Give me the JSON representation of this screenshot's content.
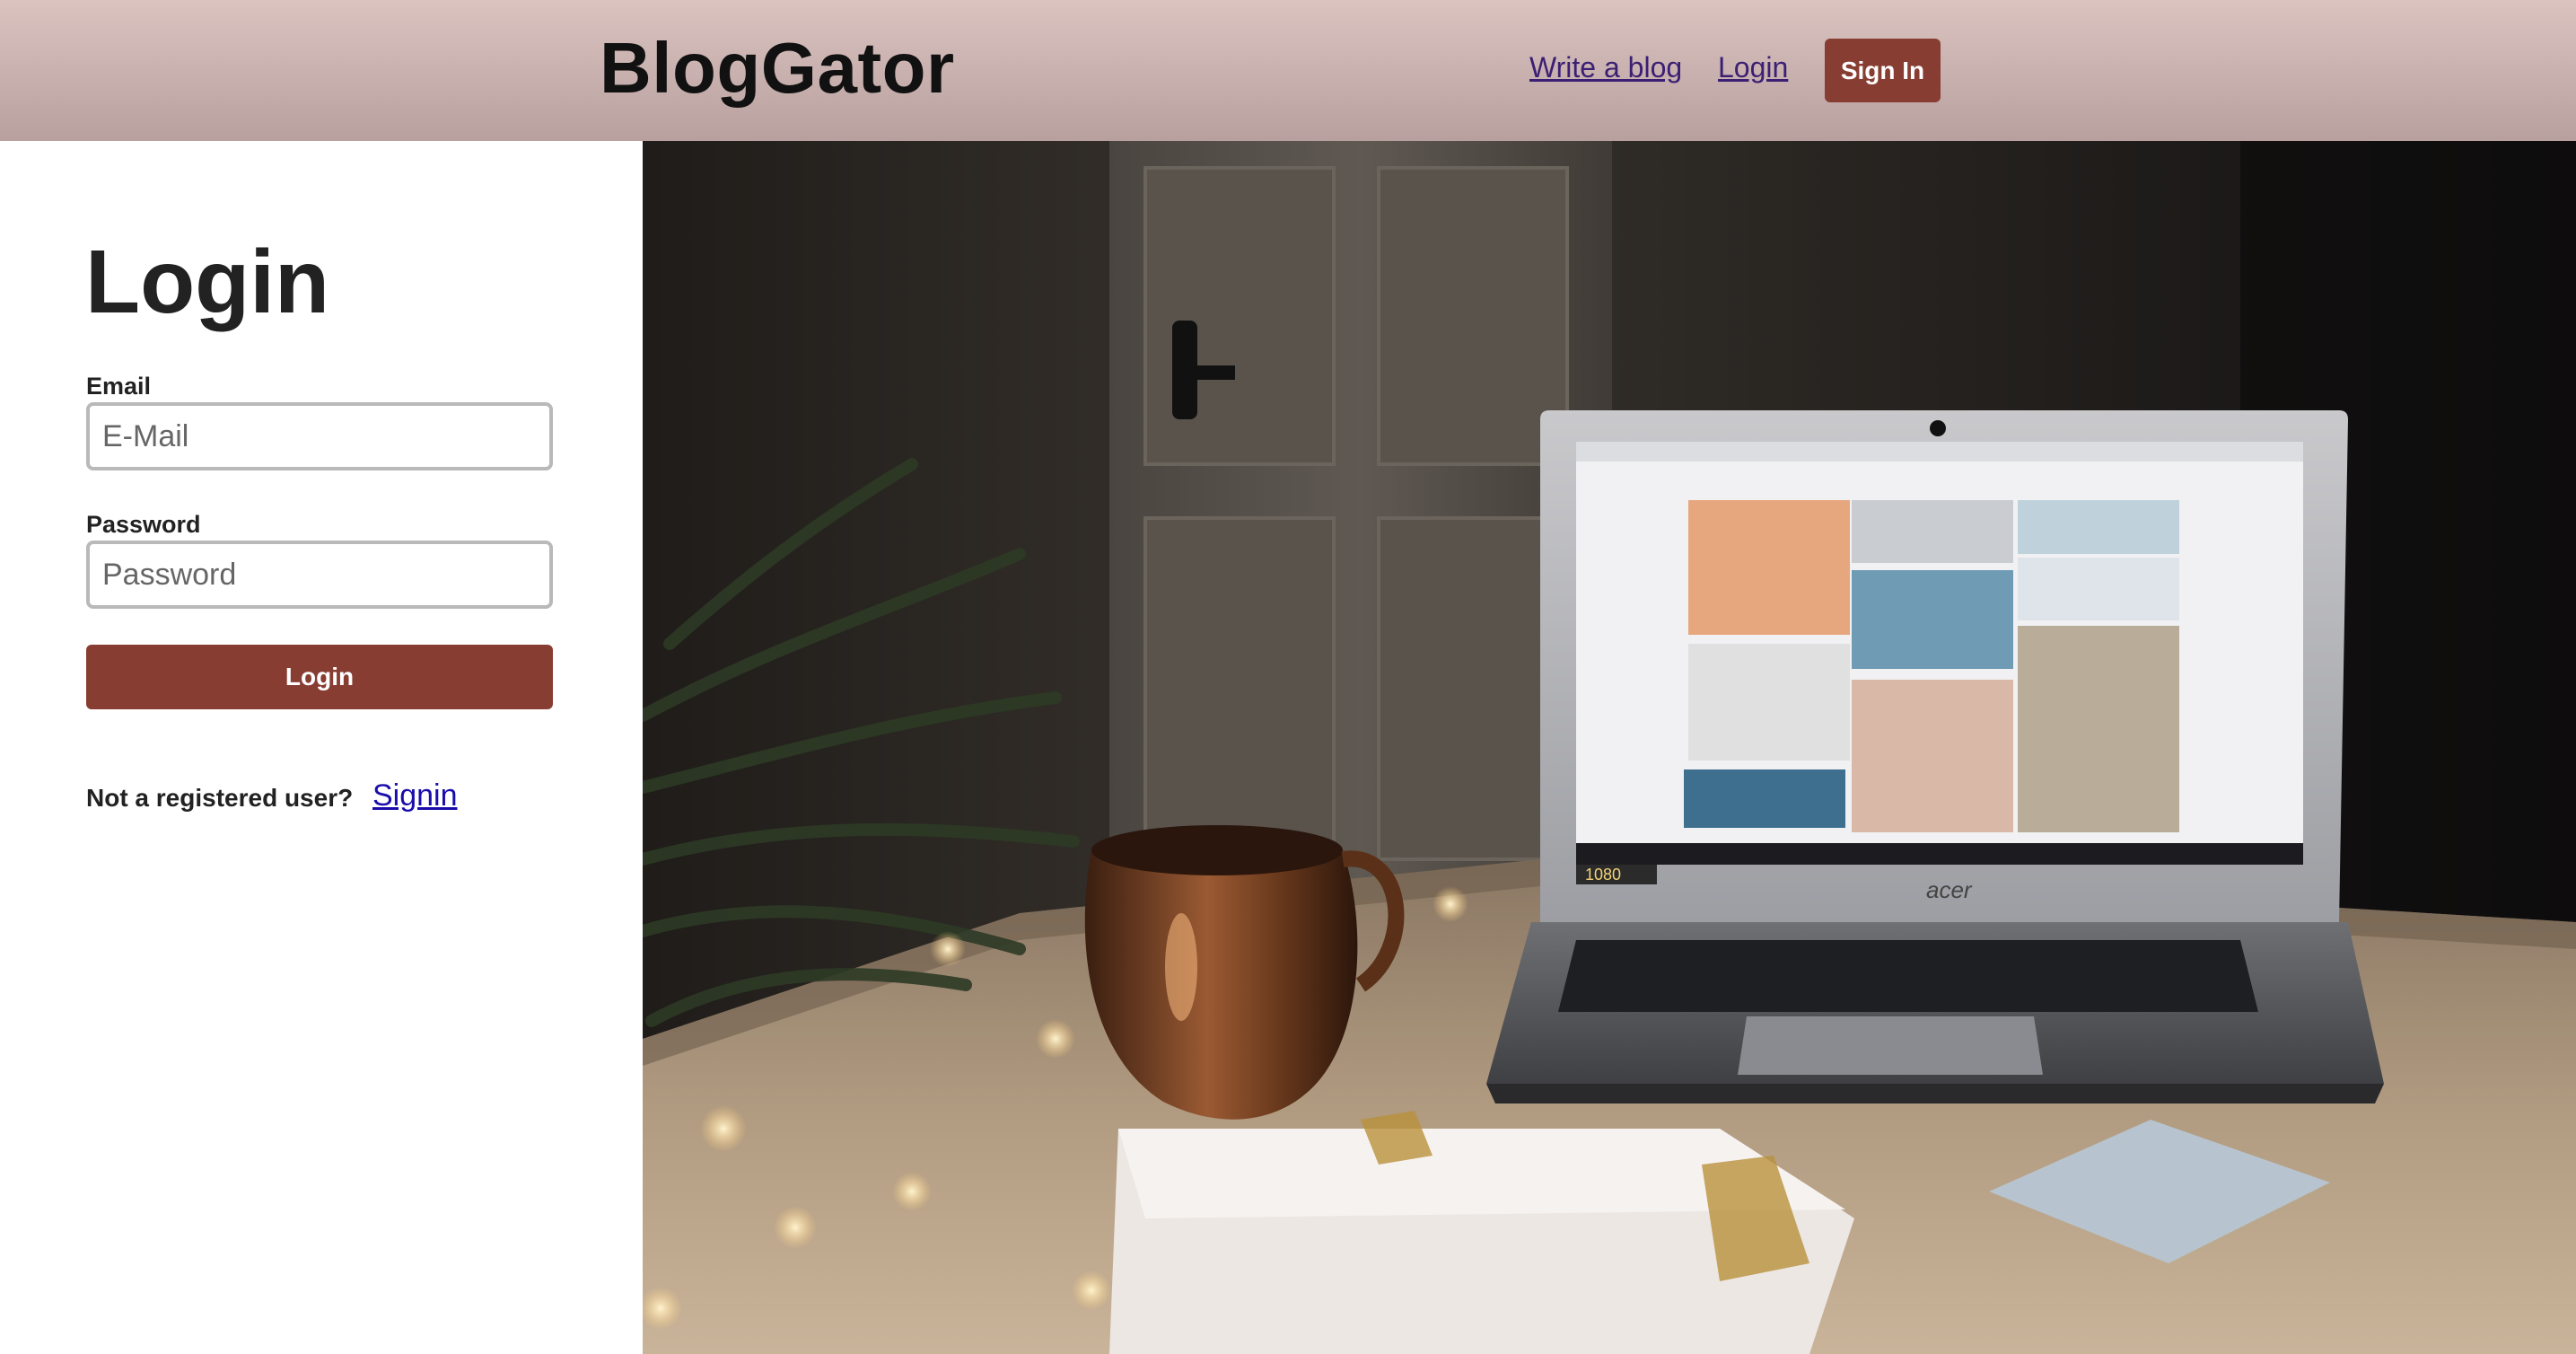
{
  "header": {
    "brand": "BlogGator",
    "nav": {
      "write_blog": "Write a blog",
      "login": "Login",
      "sign_in": "Sign In"
    }
  },
  "form": {
    "title": "Login",
    "email_label": "Email",
    "email_placeholder": "E-Mail",
    "password_label": "Password",
    "password_placeholder": "Password",
    "submit_label": "Login",
    "not_registered_text": "Not a registered user?",
    "signin_link": "Signin"
  },
  "hero_image": {
    "laptop_brand": "acer",
    "screen_badge": "1080"
  },
  "colors": {
    "accent": "#883d32",
    "header_top": "#dbc3c0",
    "header_bottom": "#b7a09e",
    "link": "#3b1f74"
  }
}
